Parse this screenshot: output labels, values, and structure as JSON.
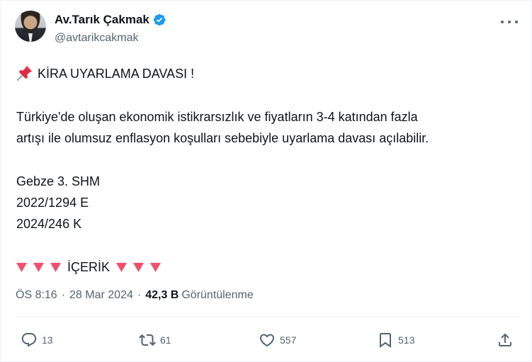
{
  "author": {
    "display_name": "Av.Tarık Çakmak",
    "handle": "@avtarikcakmak",
    "verified": true,
    "avatar_icon": "profile-photo",
    "verified_color": "#1d9bf0"
  },
  "tweet": {
    "pin_icon": "pushpin-emoji",
    "title": "KİRA UYARLAMA DAVASI !",
    "paragraph_line_1": "Türkiye'de oluşan ekonomik istikrarsızlık ve fiyatların 3-4 katından fazla",
    "paragraph_line_2": "artışı ile olumsuz enflasyon koşulları sebebiyle uyarlama davası açılabilir.",
    "court": "Gebze 3. SHM",
    "case_no_e": "2022/1294 E",
    "case_no_k": "2024/246 K",
    "content_label": "İÇERİK",
    "triangle_icon": "red-down-triangle-emoji",
    "triangle_color": "#f0506e"
  },
  "meta": {
    "time": "ÖS 8:16",
    "separator": "·",
    "date": "28 Mar 2024",
    "views_count": "42,3 B",
    "views_label": "Görüntülenme"
  },
  "actions": {
    "reply_count": "13",
    "retweet_count": "61",
    "like_count": "557",
    "bookmark_count": "513"
  }
}
